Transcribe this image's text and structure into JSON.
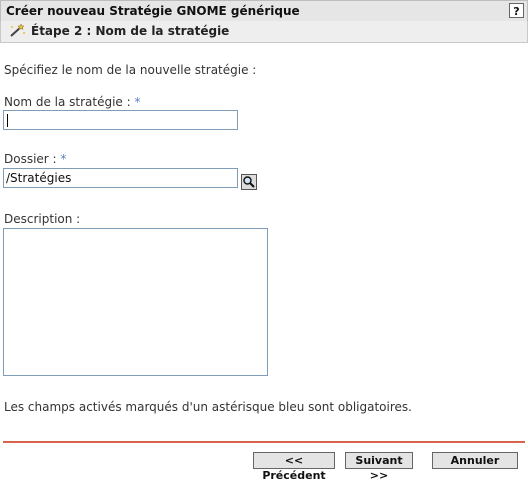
{
  "header": {
    "title": "Créer nouveau Stratégie GNOME générique",
    "help_label": "?"
  },
  "step": {
    "title": "Étape 2 : Nom de la stratégie"
  },
  "form": {
    "intro": "Spécifiez le nom de la nouvelle stratégie :",
    "name_label": "Nom de la stratégie :",
    "name_value": "",
    "required_marker": "*",
    "folder_label": "Dossier :",
    "folder_value": "/Stratégies",
    "description_label": "Description :",
    "description_value": "",
    "required_note": "Les champs activés marqués d'un astérisque bleu sont obligatoires."
  },
  "buttons": {
    "back": "<< Précédent",
    "next": "Suivant >>",
    "cancel": "Annuler"
  },
  "colors": {
    "required_asterisk": "#5a7fc4",
    "divider": "#d9634a"
  }
}
